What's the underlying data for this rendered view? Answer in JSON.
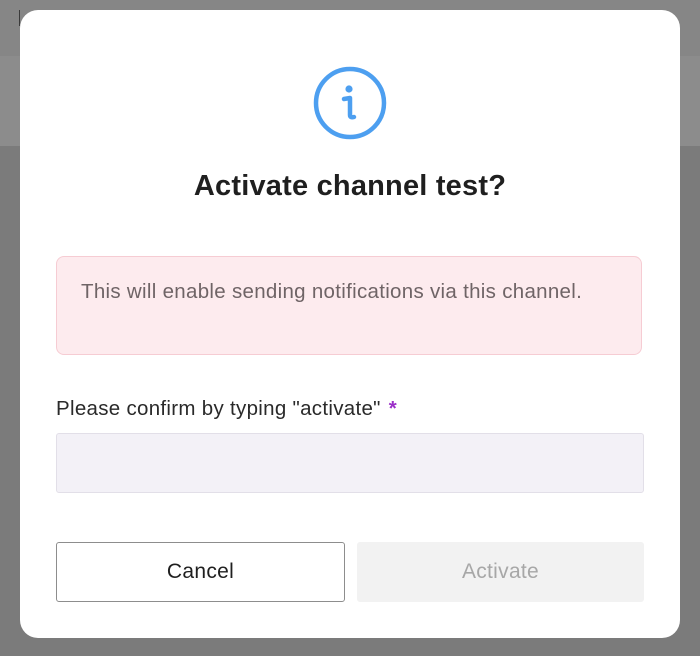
{
  "dialog": {
    "icon": "info-icon",
    "title": "Activate channel test?",
    "alert_text": "This will enable sending notifications via this channel.",
    "confirm_label": "Please confirm by typing \"activate\"",
    "required_marker": "*",
    "confirm_input": {
      "value": "",
      "placeholder": ""
    },
    "cancel_label": "Cancel",
    "activate_label": "Activate",
    "activate_disabled": true
  },
  "colors": {
    "info_icon": "#4d9ff0",
    "alert_bg": "#fdebee",
    "alert_border": "#f6ccd3",
    "required": "#9b2fc8",
    "backdrop": "#7b7b7b"
  }
}
